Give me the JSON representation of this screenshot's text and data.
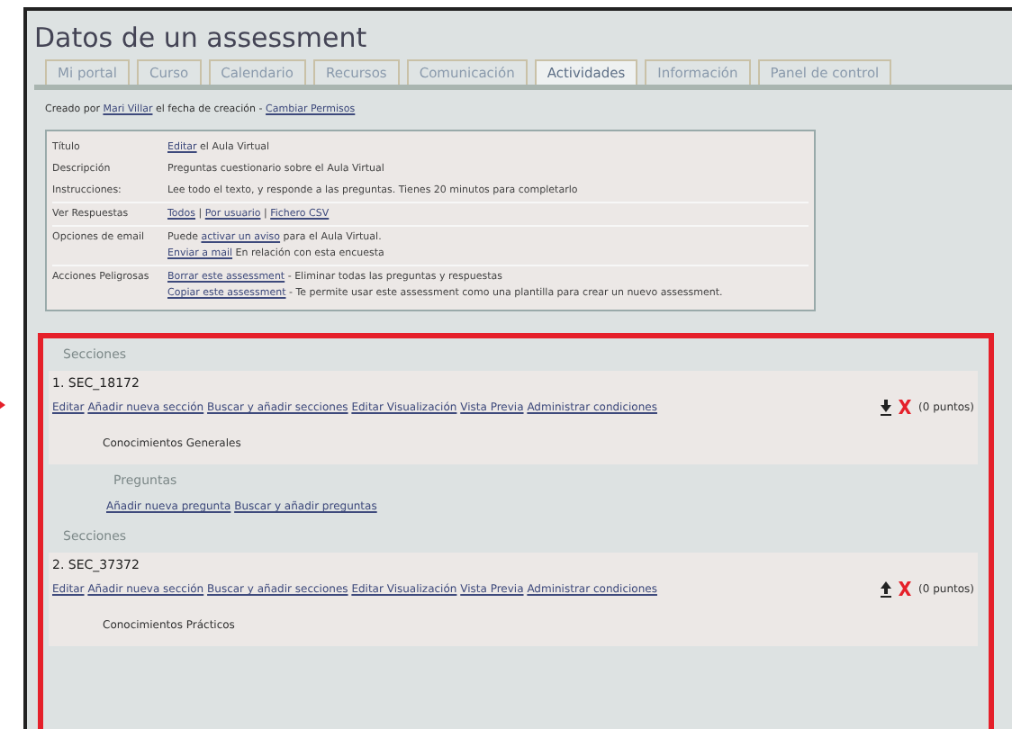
{
  "title": "Datos de un assessment",
  "tabs": [
    {
      "label": "Mi portal",
      "selected": false
    },
    {
      "label": "Curso",
      "selected": false
    },
    {
      "label": "Calendario",
      "selected": false
    },
    {
      "label": "Recursos",
      "selected": false
    },
    {
      "label": "Comunicación",
      "selected": false
    },
    {
      "label": "Actividades",
      "selected": true
    },
    {
      "label": "Información",
      "selected": false
    },
    {
      "label": "Panel de control",
      "selected": false
    }
  ],
  "created": [
    {
      "text": "Creado por",
      "link": false
    },
    {
      "text": "Mari Villar",
      "link": true
    },
    {
      "text": "el fecha de creación -",
      "link": false
    },
    {
      "text": "Cambiar Permisos",
      "link": true
    }
  ],
  "info": [
    {
      "label": "Título",
      "lines": [
        [
          {
            "text": "Editar",
            "link": true
          },
          {
            "text": "el Aula Virtual",
            "link": false
          }
        ]
      ]
    },
    {
      "label": "Descripción",
      "lines": [
        [
          {
            "text": "Preguntas cuestionario sobre el Aula Virtual",
            "link": false
          }
        ]
      ]
    },
    {
      "label": "Instrucciones:",
      "lines": [
        [
          {
            "text": "Lee todo el texto, y responde a las preguntas. Tienes 20 minutos para completarlo",
            "link": false
          }
        ]
      ]
    },
    {
      "label": "Ver Respuestas",
      "lines": [
        [
          {
            "text": "Todos",
            "link": true
          },
          {
            "text": "|",
            "link": false
          },
          {
            "text": "Por usuario",
            "link": true
          },
          {
            "text": "|",
            "link": false
          },
          {
            "text": "Fichero CSV",
            "link": true
          }
        ]
      ]
    },
    {
      "label": "Opciones de email",
      "lines": [
        [
          {
            "text": "Puede",
            "link": false
          },
          {
            "text": "activar un aviso",
            "link": true
          },
          {
            "text": "para el Aula Virtual.",
            "link": false
          }
        ],
        [
          {
            "text": "Enviar a mail",
            "link": true
          },
          {
            "text": "En relación con esta encuesta",
            "link": false
          }
        ]
      ]
    },
    {
      "label": "Acciones Peligrosas",
      "lines": [
        [
          {
            "text": "Borrar este assessment",
            "link": true
          },
          {
            "text": "- Eliminar todas las preguntas y respuestas",
            "link": false
          }
        ],
        [
          {
            "text": "Copiar este assessment",
            "link": true
          },
          {
            "text": "- Te permite usar este assessment como una plantilla para crear un nuevo assessment.",
            "link": false
          }
        ]
      ]
    }
  ],
  "blocks": [
    {
      "kind": "section",
      "heading": "Secciones",
      "name": "1. SEC_18172",
      "links": [
        "Editar",
        "Añadir nueva sección",
        "Buscar y añadir secciones",
        "Editar Visualización",
        "Vista Previa",
        "Administrar condiciones"
      ],
      "up_arrow": false,
      "points": "(0 puntos)",
      "body": "Conocimientos Generales"
    },
    {
      "kind": "questions",
      "heading": "Preguntas",
      "links": [
        "Añadir nueva pregunta",
        "Buscar y añadir preguntas"
      ]
    },
    {
      "kind": "section",
      "heading": "Secciones",
      "name": "2. SEC_37372",
      "links": [
        "Editar",
        "Añadir nueva sección",
        "Buscar y añadir secciones",
        "Editar Visualización",
        "Vista Previa",
        "Administrar condiciones"
      ],
      "up_arrow": true,
      "points": "(0 puntos)",
      "body": "Conocimientos Prácticos"
    }
  ]
}
